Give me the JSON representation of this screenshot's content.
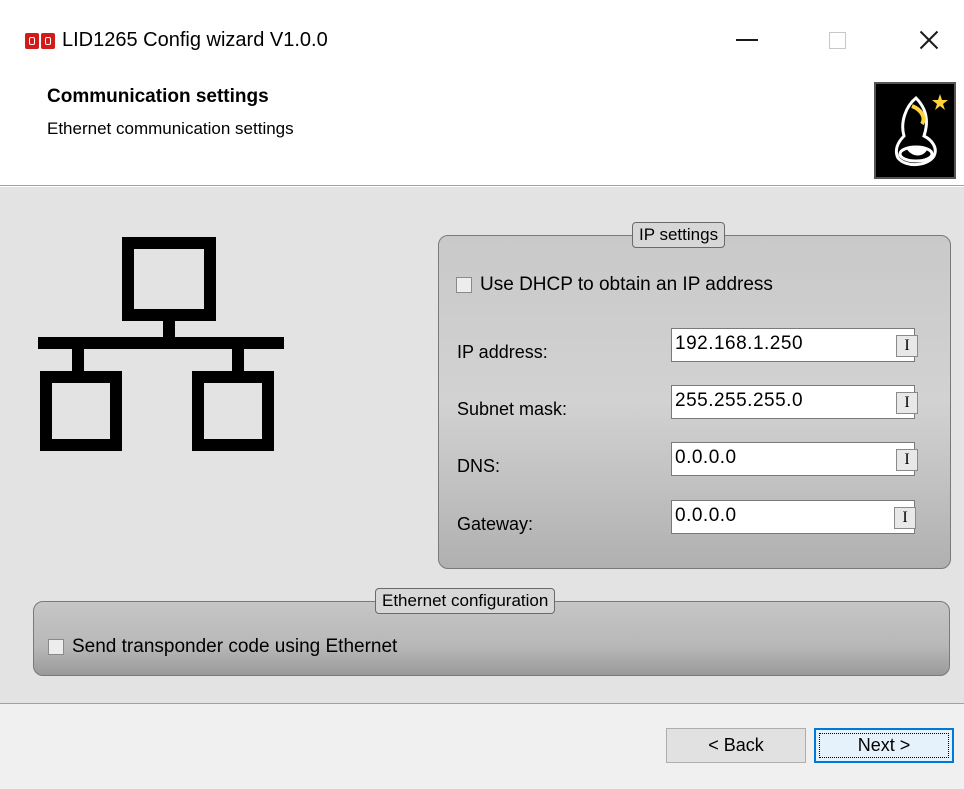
{
  "window": {
    "title": "LID1265 Config wizard V1.0.0",
    "icons": {
      "app": "app-logo-icon",
      "minimize": "minimize-icon",
      "maximize": "maximize-icon",
      "close": "close-icon"
    }
  },
  "header": {
    "title": "Communication settings",
    "subtitle": "Ethernet communication settings",
    "logo_icon": "wizard-hat-icon"
  },
  "main": {
    "network_icon": "network-icon",
    "ip_settings": {
      "legend": "IP settings",
      "dhcp_label": "Use DHCP to obtain an IP address",
      "dhcp_checked": false,
      "fields": [
        {
          "label": "IP address:",
          "value": "192.168.1.250"
        },
        {
          "label": "Subnet mask:",
          "value": "255.255.255.0"
        },
        {
          "label": "DNS:",
          "value": "0.0.0.0"
        },
        {
          "label": "Gateway:",
          "value": "0.0.0.0"
        }
      ],
      "cursor_glyph": "I"
    },
    "ethernet_config": {
      "legend": "Ethernet configuration",
      "send_label": "Send transponder code using Ethernet",
      "send_checked": false
    }
  },
  "footer": {
    "back_label": "< Back",
    "next_label": "Next >"
  },
  "colors": {
    "focus_border": "#0078d7",
    "group_bg": "#c6c6c6"
  }
}
